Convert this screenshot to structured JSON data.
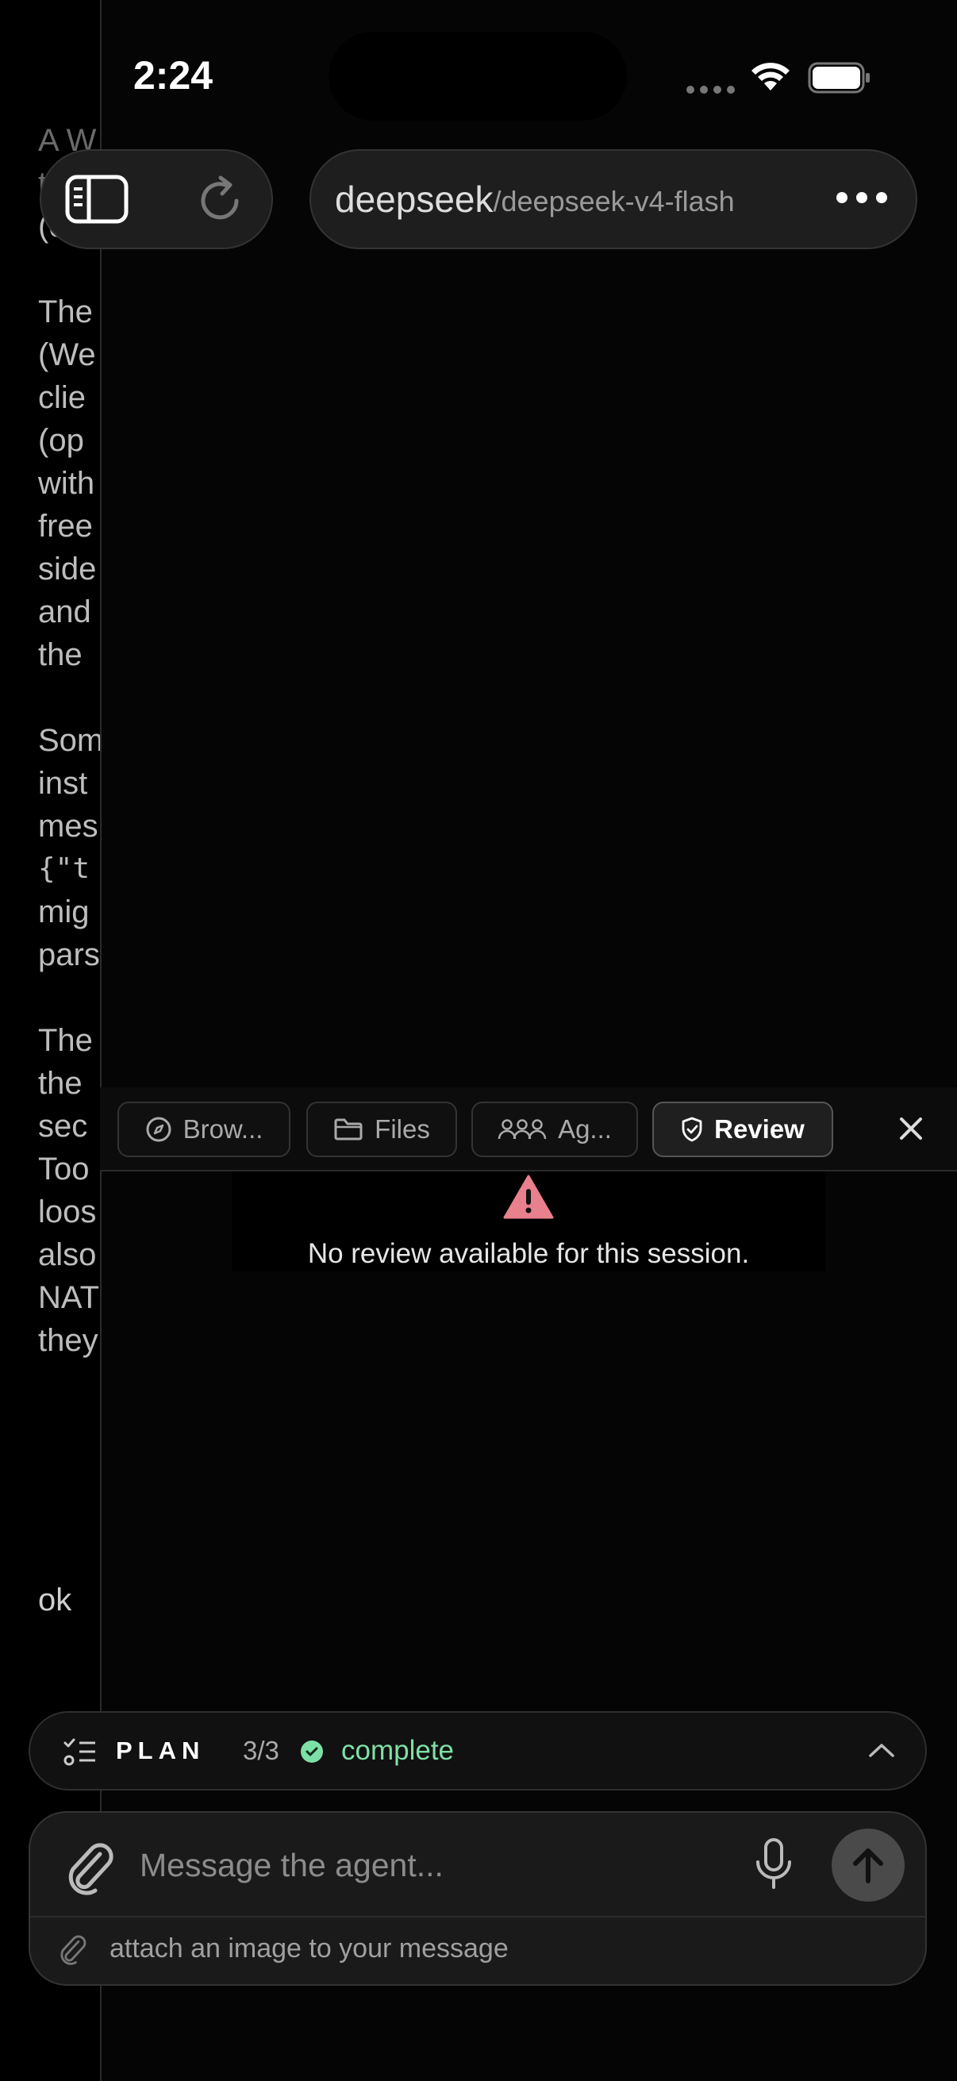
{
  "status_bar": {
    "time": "2:24"
  },
  "background_chat": {
    "paragraphs": [
      [
        "A W",
        "t",
        "(con"
      ],
      [
        "The",
        "(We",
        "clie",
        "(op",
        "with",
        "free",
        "side",
        "and",
        "the"
      ],
      [
        "Som",
        "inst",
        "mes",
        "{\"t",
        "mig",
        "pars"
      ],
      [
        "The",
        "the",
        "sec",
        "Too",
        "loos",
        "also",
        "NAT",
        "they"
      ]
    ],
    "last_message": "ok"
  },
  "url_bar": {
    "brand": "deepseek",
    "model": "/deepseek-v4-flash"
  },
  "tabs": [
    {
      "label": "Brow...",
      "icon": "compass-icon",
      "active": false
    },
    {
      "label": "Files",
      "icon": "folder-icon",
      "active": false
    },
    {
      "label": "Ag...",
      "icon": "agents-icon",
      "active": false
    },
    {
      "label": "Review",
      "icon": "shield-check-icon",
      "active": true
    }
  ],
  "review": {
    "message": "No review available for this session."
  },
  "plan": {
    "label": "PLAN",
    "count": "3/3",
    "status": "complete"
  },
  "composer": {
    "placeholder": "Message the agent...",
    "hint": "attach an image to your message"
  },
  "colors": {
    "accent_green": "#7ee0a6",
    "warning": "#e8808d",
    "background": "#000000"
  }
}
